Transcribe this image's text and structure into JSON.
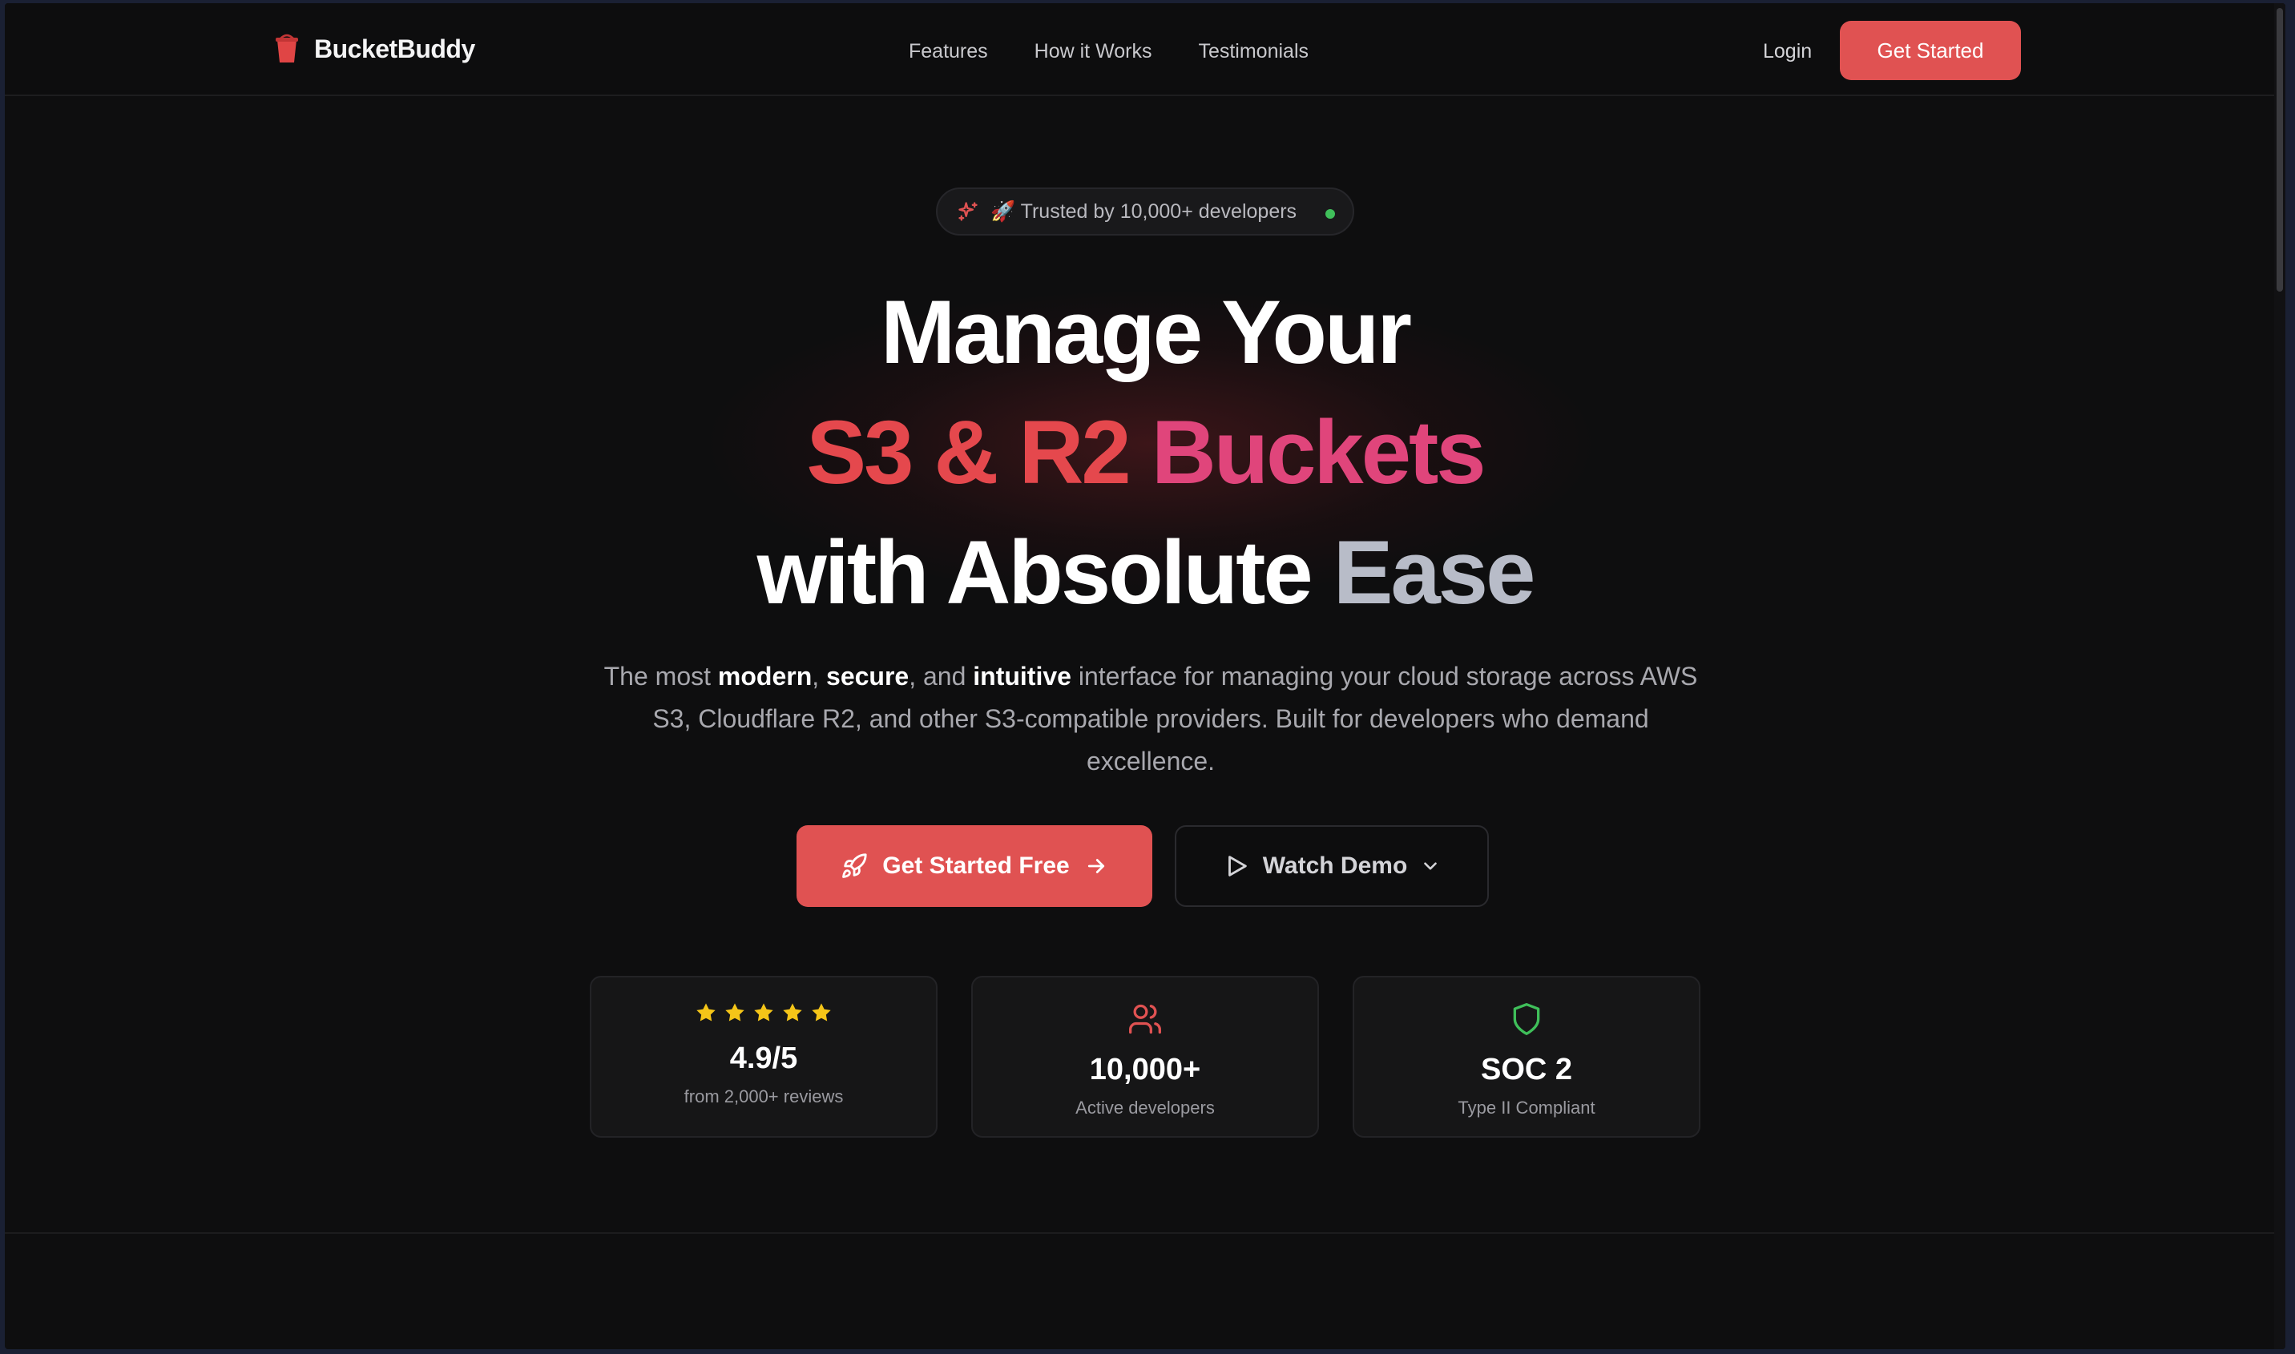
{
  "nav": {
    "brand": "BucketBuddy",
    "links": [
      "Features",
      "How it Works",
      "Testimonials"
    ],
    "login": "Login",
    "cta": "Get Started"
  },
  "hero": {
    "badge": "🚀 Trusted by 10,000+ developers",
    "line1": "Manage Your",
    "line2_a": "S3 & R2 ",
    "line2_b": "Buckets",
    "line3_a": "with Absolute ",
    "line3_b": "Ease",
    "subtitle": {
      "p1": "The most ",
      "w1": "modern",
      "p2": ", ",
      "w2": "secure",
      "p3": ", and ",
      "w3": "intuitive",
      "p4": " interface for managing your cloud storage across AWS S3, Cloudflare R2, and other S3-compatible providers. Built for developers who demand excellence."
    },
    "primary_button": "Get Started Free",
    "secondary_button": "Watch Demo"
  },
  "stats": [
    {
      "icon": "star-icon",
      "stars": 5,
      "value": "4.9/5",
      "label": "from 2,000+ reviews"
    },
    {
      "icon": "users-icon",
      "value": "10,000+",
      "label": "Active developers"
    },
    {
      "icon": "shield-icon",
      "value": "SOC 2",
      "label": "Type II Compliant"
    }
  ],
  "colors": {
    "accent": "#e05252",
    "star": "#f5c518",
    "shield": "#3fbf5a",
    "background": "#0e0e0f"
  }
}
